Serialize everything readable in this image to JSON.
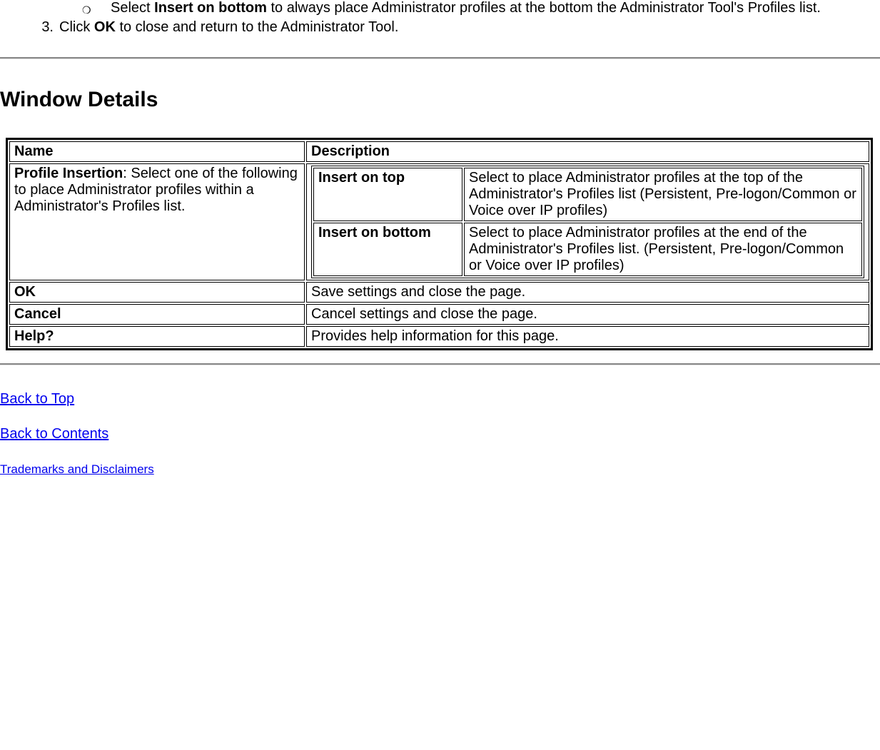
{
  "intro": {
    "sub_bullet_before": "Select ",
    "sub_bullet_bold": "Insert on bottom",
    "sub_bullet_after": " to always place Administrator profiles at the bottom the Administrator Tool's Profiles list.",
    "numbered_marker": "3.",
    "numbered_before": "Click ",
    "numbered_bold": "OK",
    "numbered_after": " to close and return to the Administrator Tool."
  },
  "section_heading": "Window Details",
  "table": {
    "header_name": "Name",
    "header_desc": "Description",
    "row1_name_bold": "Profile Insertion",
    "row1_name_rest": ": Select one of the following to place Administrator profiles within a Administrator's Profiles list.",
    "row1_opt1_label": "Insert on top",
    "row1_opt1_desc": "Select to place Administrator profiles at the top of the Administrator's Profiles list (Persistent, Pre-logon/Common or Voice over IP profiles)",
    "row1_opt2_label": "Insert on bottom",
    "row1_opt2_desc": "Select to place Administrator profiles at the end of the Administrator's Profiles list. (Persistent, Pre-logon/Common or Voice over IP profiles)",
    "row2_name": "OK",
    "row2_desc": "Save settings and close the page.",
    "row3_name": "Cancel",
    "row3_desc": "Cancel settings and close the page.",
    "row4_name": "Help?",
    "row4_desc": "Provides help information for this page."
  },
  "links": {
    "back_top": "Back to Top",
    "back_contents": "Back to Contents",
    "trademarks": "Trademarks and Disclaimers"
  }
}
